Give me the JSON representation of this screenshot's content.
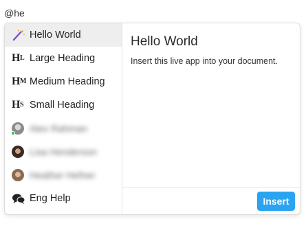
{
  "query": "@he",
  "items": [
    {
      "label": "Hello World",
      "icon": "magic-wand-icon",
      "selected": true
    },
    {
      "label": "Large Heading",
      "icon": "heading-large-icon",
      "glyph": "H",
      "sub": "L"
    },
    {
      "label": "Medium Heading",
      "icon": "heading-medium-icon",
      "glyph": "H",
      "sub": "M"
    },
    {
      "label": "Small Heading",
      "icon": "heading-small-icon",
      "glyph": "H",
      "sub": "S"
    },
    {
      "label": "Alex Rahman",
      "icon": "avatar"
    },
    {
      "label": "Lisa Henderson",
      "icon": "avatar"
    },
    {
      "label": "Heather Hefner",
      "icon": "avatar"
    },
    {
      "label": "Eng Help",
      "icon": "chat-bubbles-icon"
    }
  ],
  "detail": {
    "title": "Hello World",
    "description": "Insert this live app into your document."
  },
  "footer": {
    "insert_label": "Insert"
  },
  "colors": {
    "accent": "#2aa4f1",
    "selected_bg": "#eeeeee",
    "online": "#3fb950"
  }
}
